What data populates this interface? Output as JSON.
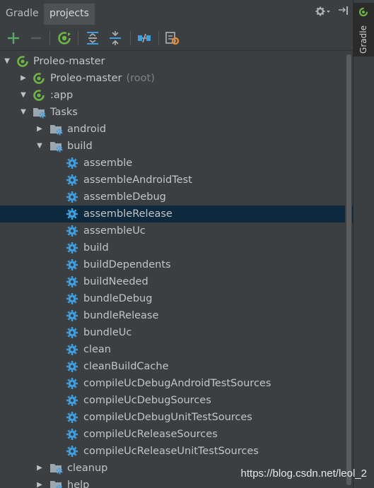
{
  "header": {
    "tabs": [
      "Gradle",
      "projects"
    ]
  },
  "side": {
    "label": "Gradle"
  },
  "tree": [
    {
      "label": "Proleo-master",
      "sub": "",
      "level": 0,
      "icon": "gradle-module-icon",
      "arrow": "down"
    },
    {
      "label": "Proleo-master",
      "sub": "(root)",
      "level": 1,
      "icon": "gradle-module-icon",
      "arrow": "right"
    },
    {
      "label": ":app",
      "sub": "",
      "level": 1,
      "icon": "gradle-module-icon",
      "arrow": "down"
    },
    {
      "label": "Tasks",
      "sub": "",
      "level": 2,
      "icon": "folder-gear-icon",
      "arrow": "down"
    },
    {
      "label": "android",
      "sub": "",
      "level": 3,
      "icon": "folder-gear-icon",
      "arrow": "right"
    },
    {
      "label": "build",
      "sub": "",
      "level": 3,
      "icon": "folder-gear-icon",
      "arrow": "down"
    },
    {
      "label": "assemble",
      "sub": "",
      "level": 4,
      "icon": "gear-icon",
      "arrow": ""
    },
    {
      "label": "assembleAndroidTest",
      "sub": "",
      "level": 4,
      "icon": "gear-icon",
      "arrow": ""
    },
    {
      "label": "assembleDebug",
      "sub": "",
      "level": 4,
      "icon": "gear-icon",
      "arrow": ""
    },
    {
      "label": "assembleRelease",
      "sub": "",
      "level": 4,
      "icon": "gear-icon",
      "arrow": "",
      "selected": true
    },
    {
      "label": "assembleUc",
      "sub": "",
      "level": 4,
      "icon": "gear-icon",
      "arrow": ""
    },
    {
      "label": "build",
      "sub": "",
      "level": 4,
      "icon": "gear-icon",
      "arrow": ""
    },
    {
      "label": "buildDependents",
      "sub": "",
      "level": 4,
      "icon": "gear-icon",
      "arrow": ""
    },
    {
      "label": "buildNeeded",
      "sub": "",
      "level": 4,
      "icon": "gear-icon",
      "arrow": ""
    },
    {
      "label": "bundleDebug",
      "sub": "",
      "level": 4,
      "icon": "gear-icon",
      "arrow": ""
    },
    {
      "label": "bundleRelease",
      "sub": "",
      "level": 4,
      "icon": "gear-icon",
      "arrow": ""
    },
    {
      "label": "bundleUc",
      "sub": "",
      "level": 4,
      "icon": "gear-icon",
      "arrow": ""
    },
    {
      "label": "clean",
      "sub": "",
      "level": 4,
      "icon": "gear-icon",
      "arrow": ""
    },
    {
      "label": "cleanBuildCache",
      "sub": "",
      "level": 4,
      "icon": "gear-icon",
      "arrow": ""
    },
    {
      "label": "compileUcDebugAndroidTestSources",
      "sub": "",
      "level": 4,
      "icon": "gear-icon",
      "arrow": ""
    },
    {
      "label": "compileUcDebugSources",
      "sub": "",
      "level": 4,
      "icon": "gear-icon",
      "arrow": ""
    },
    {
      "label": "compileUcDebugUnitTestSources",
      "sub": "",
      "level": 4,
      "icon": "gear-icon",
      "arrow": ""
    },
    {
      "label": "compileUcReleaseSources",
      "sub": "",
      "level": 4,
      "icon": "gear-icon",
      "arrow": ""
    },
    {
      "label": "compileUcReleaseUnitTestSources",
      "sub": "",
      "level": 4,
      "icon": "gear-icon",
      "arrow": ""
    },
    {
      "label": "cleanup",
      "sub": "",
      "level": 3,
      "icon": "folder-gear-icon",
      "arrow": "right"
    },
    {
      "label": "help",
      "sub": "",
      "level": 3,
      "icon": "folder-gear-icon",
      "arrow": "right"
    }
  ],
  "watermark": "https://blog.csdn.net/leol_2",
  "colors": {
    "background": "#3c3f41",
    "selection": "#0d293e",
    "gear": "#3d9ee0",
    "gradle_green": "#6fb546",
    "add_green": "#59a869"
  }
}
